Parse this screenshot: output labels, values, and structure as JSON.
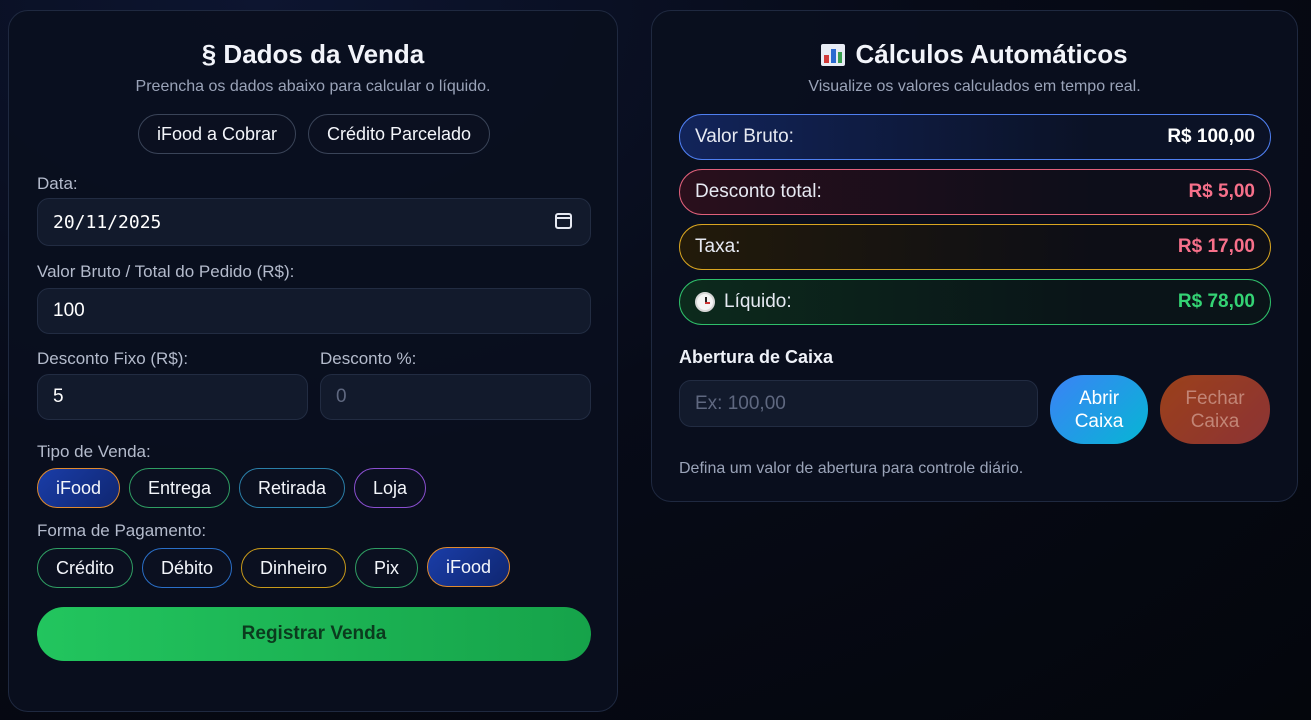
{
  "left": {
    "title": "§ Dados da Venda",
    "subtitle": "Preencha os dados abaixo para calcular o líquido.",
    "quick_buttons": [
      "iFood a Cobrar",
      "Crédito Parcelado"
    ],
    "date_label": "Data:",
    "date_value": "20/11/2025",
    "gross_label": "Valor Bruto / Total do Pedido (R$):",
    "gross_value": "100",
    "fixed_discount_label": "Desconto Fixo (R$):",
    "fixed_discount_value": "5",
    "percent_discount_label": "Desconto %:",
    "percent_discount_placeholder": "0",
    "sale_type_label": "Tipo de Venda:",
    "sale_types": [
      "iFood",
      "Entrega",
      "Retirada",
      "Loja"
    ],
    "sale_type_selected": "iFood",
    "payment_label": "Forma de Pagamento:",
    "payments": [
      "Crédito",
      "Débito",
      "Dinheiro",
      "Pix",
      "iFood"
    ],
    "payment_selected": "iFood",
    "submit_label": "Registrar Venda"
  },
  "right": {
    "title": "Cálculos Automáticos",
    "title_icon": "bar-chart-icon",
    "subtitle": "Visualize os valores calculados em tempo real.",
    "rows": [
      {
        "label": "Valor Bruto:",
        "value": "R$ 100,00",
        "color": "#4f7ff0"
      },
      {
        "label": "Desconto total:",
        "value": "R$ 5,00",
        "color": "#e0607a"
      },
      {
        "label": "Taxa:",
        "value": "R$ 17,00",
        "color": "#d9a520"
      },
      {
        "label": "Líquido:",
        "value": "R$ 78,00",
        "color": "#2fbf6a",
        "icon": "clock-icon"
      }
    ],
    "cash_title": "Abertura de Caixa",
    "cash_placeholder": "Ex: 100,00",
    "open_label": "Abrir Caixa",
    "close_label": "Fechar Caixa",
    "hint": "Defina um valor de abertura para controle diário."
  },
  "colors": {
    "accent_blue": "#1a3da8",
    "accent_green": "#22c55e",
    "selected_border": "#e08a2e"
  }
}
